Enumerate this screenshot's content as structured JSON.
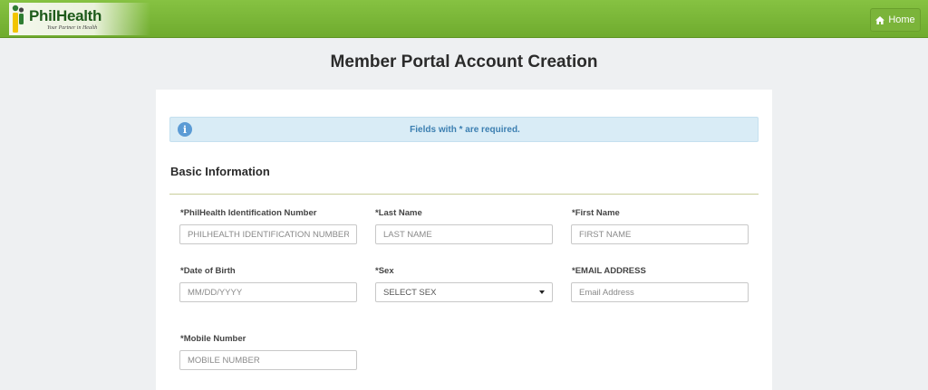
{
  "header": {
    "logo_title": "PhilHealth",
    "logo_tagline": "Your Partner in Health",
    "home_label": "Home",
    "home_icon": "home-icon"
  },
  "page": {
    "title": "Member Portal Account Creation"
  },
  "alert": {
    "icon": "info-icon",
    "icon_glyph": "i",
    "text": "Fields with * are required."
  },
  "section": {
    "title": "Basic Information"
  },
  "fields": {
    "pin": {
      "label": "*PhilHealth Identification Number",
      "placeholder": "PHILHEALTH IDENTIFICATION NUMBER",
      "value": ""
    },
    "last_name": {
      "label": "*Last Name",
      "placeholder": "LAST NAME",
      "value": ""
    },
    "first_name": {
      "label": "*First Name",
      "placeholder": "FIRST NAME",
      "value": ""
    },
    "dob": {
      "label": "*Date of Birth",
      "placeholder": "MM/DD/YYYY",
      "value": ""
    },
    "sex": {
      "label": "*Sex",
      "selected": "SELECT SEX"
    },
    "email": {
      "label": "*EMAIL ADDRESS",
      "placeholder": "Email Address",
      "value": ""
    },
    "mobile": {
      "label": "*Mobile Number",
      "placeholder": "MOBILE NUMBER",
      "value": ""
    }
  },
  "colors": {
    "header_green": "#7bb43a",
    "alert_bg": "#d9ecf6",
    "alert_text": "#3c7fb1",
    "divider": "#c9ce9a"
  }
}
